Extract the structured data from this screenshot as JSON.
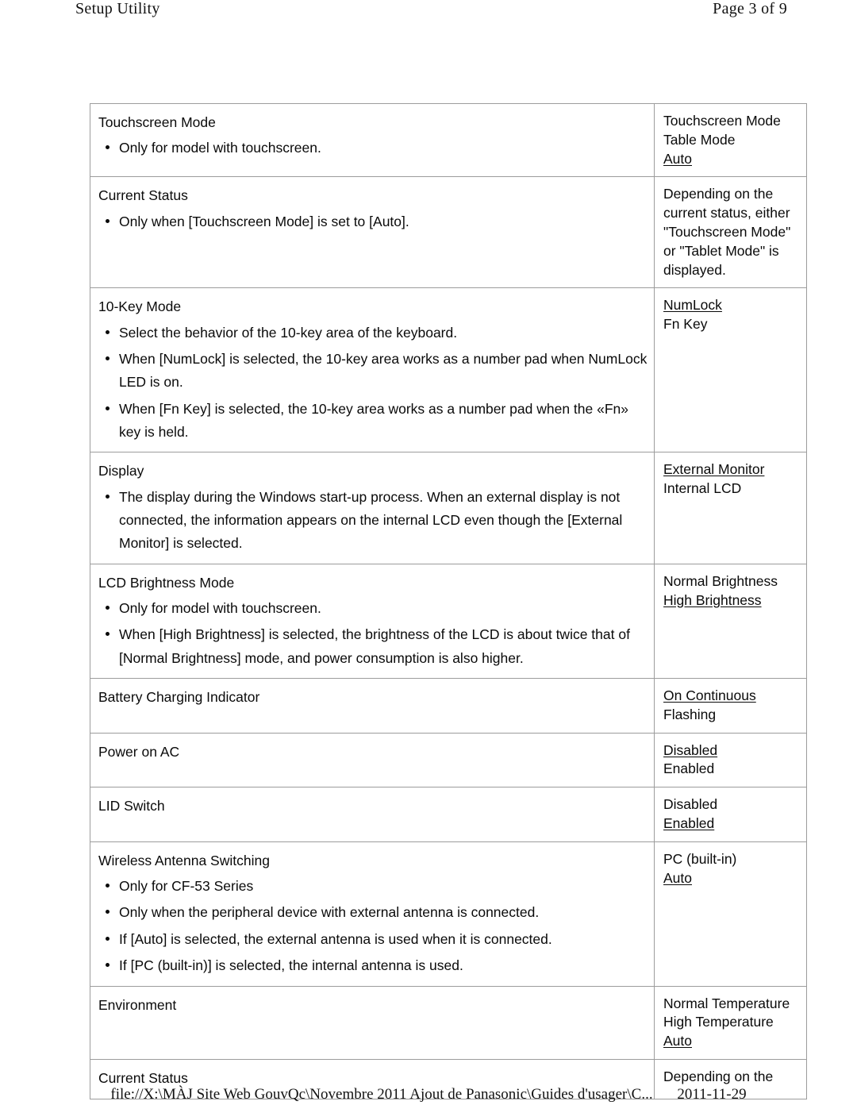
{
  "header": {
    "title": "Setup Utility",
    "page_label": "Page 3 of 9"
  },
  "footer": {
    "file_path": "file://X:\\MÀJ Site Web GouvQc\\Novembre 2011 Ajout de Panasonic\\Guides d'usager\\C...",
    "date": "2011-11-29"
  },
  "table": {
    "rows": [
      {
        "title": "Touchscreen Mode",
        "bullets": [
          "Only for model with touchscreen."
        ],
        "options": [
          {
            "label": "Touchscreen Mode",
            "default": false
          },
          {
            "label": "Table Mode",
            "default": false
          },
          {
            "label": "Auto",
            "default": true
          }
        ],
        "note": ""
      },
      {
        "title": "Current Status",
        "bullets": [
          "Only when [Touchscreen Mode] is set to [Auto]."
        ],
        "options": [],
        "note": "Depending on the current status, either \"Touchscreen Mode\" or \"Tablet Mode\" is displayed."
      },
      {
        "title": "10-Key Mode",
        "bullets": [
          "Select the behavior of the 10-key area of the keyboard.",
          "When [NumLock] is selected, the 10-key area works as a number pad when NumLock LED is on.",
          "When [Fn Key] is selected, the 10-key area works as a number pad when the «Fn» key is held."
        ],
        "options": [
          {
            "label": "NumLock",
            "default": true
          },
          {
            "label": "Fn Key",
            "default": false
          }
        ],
        "note": ""
      },
      {
        "title": "Display",
        "bullets": [
          "The display during the Windows start-up process. When an external display is not connected, the information appears on the internal LCD even though the [External Monitor] is selected."
        ],
        "options": [
          {
            "label": "External Monitor",
            "default": true
          },
          {
            "label": "Internal LCD",
            "default": false
          }
        ],
        "note": ""
      },
      {
        "title": "LCD Brightness Mode",
        "bullets": [
          "Only for model with touchscreen.",
          "When [High Brightness] is selected, the brightness of the LCD is about twice that of [Normal Brightness] mode, and power consumption is also higher."
        ],
        "options": [
          {
            "label": "Normal Brightness",
            "default": false
          },
          {
            "label": "High Brightness",
            "default": true
          }
        ],
        "note": ""
      },
      {
        "title": "Battery Charging Indicator",
        "bullets": [],
        "options": [
          {
            "label": "On Continuous",
            "default": true
          },
          {
            "label": "Flashing",
            "default": false
          }
        ],
        "note": ""
      },
      {
        "title": "Power on AC",
        "bullets": [],
        "options": [
          {
            "label": "Disabled",
            "default": true
          },
          {
            "label": "Enabled",
            "default": false
          }
        ],
        "note": ""
      },
      {
        "title": "LID Switch",
        "bullets": [],
        "options": [
          {
            "label": "Disabled",
            "default": false
          },
          {
            "label": "Enabled",
            "default": true
          }
        ],
        "note": ""
      },
      {
        "title": "Wireless Antenna Switching",
        "bullets": [
          "Only for CF-53 Series",
          "Only when the peripheral device with external antenna is connected.",
          "If [Auto] is selected, the external antenna is used when it is connected.",
          "If [PC (built-in)] is selected, the internal antenna is used."
        ],
        "options": [
          {
            "label": "PC (built-in)",
            "default": false
          },
          {
            "label": "Auto",
            "default": true
          }
        ],
        "note": ""
      },
      {
        "title": "Environment",
        "bullets": [],
        "options": [
          {
            "label": "Normal Temperature",
            "default": false
          },
          {
            "label": "High Temperature",
            "default": false
          },
          {
            "label": "Auto",
            "default": true
          }
        ],
        "note": ""
      },
      {
        "title": "Current Status",
        "bullets": [],
        "options": [],
        "note": "Depending on the"
      }
    ]
  }
}
